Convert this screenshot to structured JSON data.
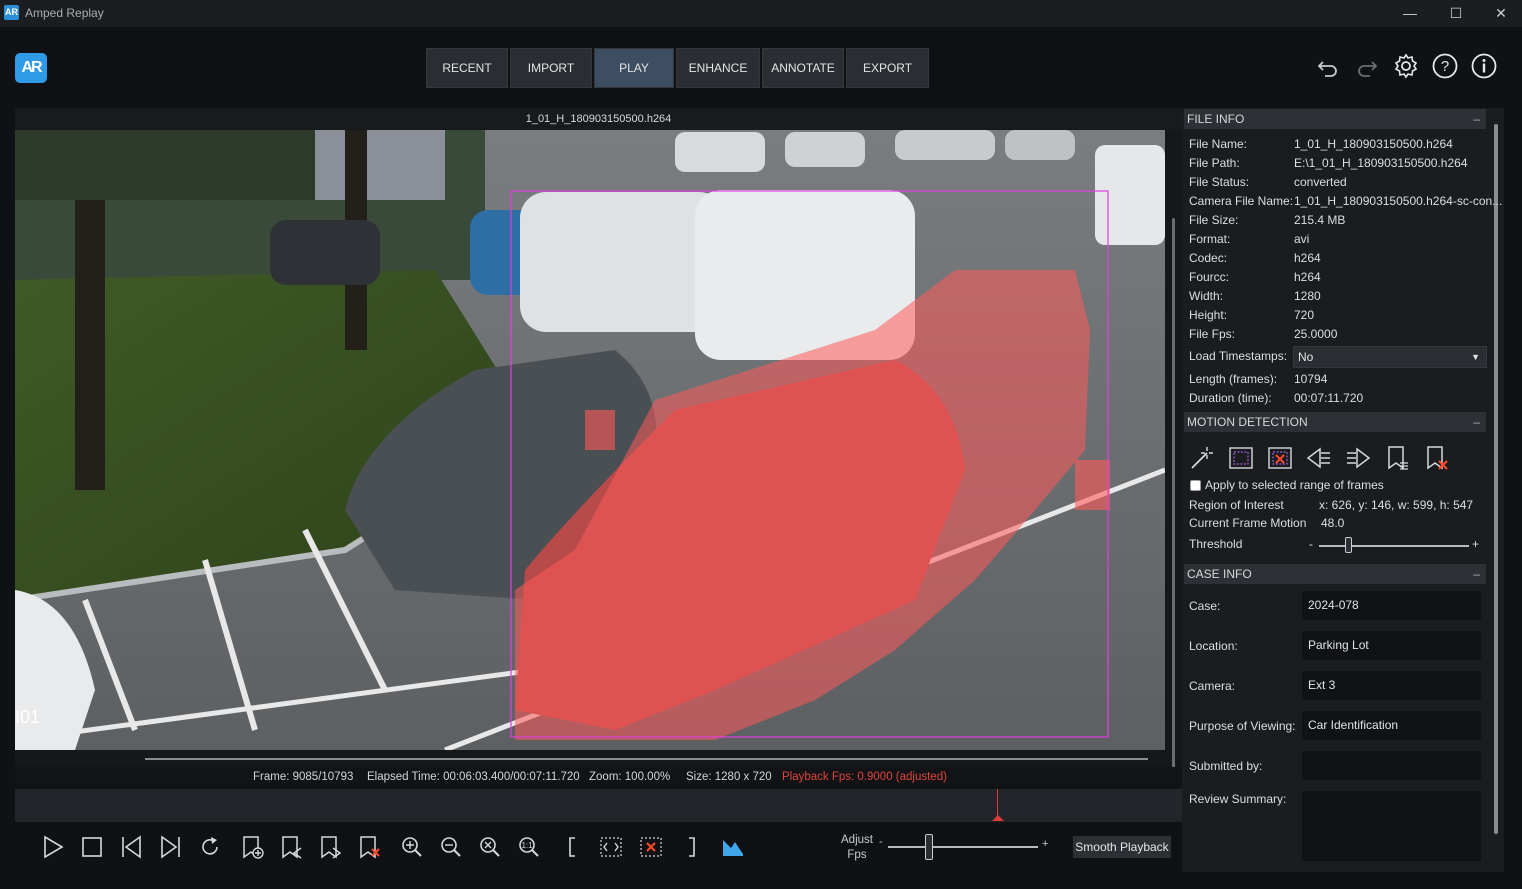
{
  "window": {
    "title": "Amped Replay",
    "icon_text": "AR",
    "minimize": "—",
    "maximize": "☐",
    "close": "✕"
  },
  "logo_text": "AR",
  "tabs": [
    {
      "label": "RECENT",
      "active": false
    },
    {
      "label": "IMPORT",
      "active": false
    },
    {
      "label": "PLAY",
      "active": true
    },
    {
      "label": "ENHANCE",
      "active": false
    },
    {
      "label": "ANNOTATE",
      "active": false
    },
    {
      "label": "EXPORT",
      "active": false
    }
  ],
  "top_icons": [
    "undo-icon",
    "redo-icon",
    "gear-icon",
    "help-icon",
    "info-icon"
  ],
  "video": {
    "filename": "1_01_H_180903150500.h264",
    "overlay_text": "I01",
    "motion_overlay_color": "#ff5a5a",
    "roi_color": "#e040e0"
  },
  "status": {
    "frame": "Frame: 9085/10793",
    "elapsed": "Elapsed Time: 00:06:03.400/00:07:11.720",
    "zoom": "Zoom: 100.00%",
    "size": "Size: 1280 x 720",
    "fps": "Playback Fps: 0.9000 (adjusted)"
  },
  "controls": {
    "buttons": [
      "play-icon",
      "stop-icon",
      "prev-frame-icon",
      "next-frame-icon",
      "loop-icon",
      "add-bookmark-icon",
      "prev-bookmark-icon",
      "next-bookmark-icon",
      "remove-bookmark-icon",
      "zoom-in-icon",
      "zoom-out-icon",
      "zoom-fit-icon",
      "zoom-100-icon",
      "range-start-icon",
      "range-select-icon",
      "range-clear-icon",
      "range-end-icon",
      "histogram-icon"
    ],
    "adjust_fps_label_1": "Adjust",
    "adjust_fps_label_2": "Fps",
    "adjust_minus": "-",
    "adjust_plus": "+",
    "smooth_playback": "Smooth Playback"
  },
  "file_info": {
    "header": "FILE INFO",
    "collapse": "–",
    "rows": [
      {
        "label": "File Name:",
        "value": "1_01_H_180903150500.h264"
      },
      {
        "label": "File Path:",
        "value": "E:\\1_01_H_180903150500.h264"
      },
      {
        "label": "File Status:",
        "value": "converted"
      },
      {
        "label": "Camera File Name:",
        "value": "1_01_H_180903150500.h264-sc-con..."
      },
      {
        "label": "File Size:",
        "value": "215.4 MB"
      },
      {
        "label": "Format:",
        "value": "avi"
      },
      {
        "label": "Codec:",
        "value": "h264"
      },
      {
        "label": "Fourcc:",
        "value": "h264"
      },
      {
        "label": "Width:",
        "value": "1280"
      },
      {
        "label": "Height:",
        "value": "720"
      },
      {
        "label": "File Fps:",
        "value": "25.0000"
      }
    ],
    "load_timestamps_label": "Load Timestamps:",
    "load_timestamps_value": "No",
    "length_label": "Length (frames):",
    "length_value": "10794",
    "duration_label": "Duration (time):",
    "duration_value": "00:07:11.720"
  },
  "motion_detection": {
    "header": "MOTION DETECTION",
    "collapse": "–",
    "tools": [
      "motion-wand-icon",
      "roi-select-icon",
      "roi-clear-icon",
      "prev-motion-icon",
      "next-motion-icon",
      "bookmark-motion-icon",
      "clear-bookmarks-icon"
    ],
    "apply_label": "Apply to selected range of frames",
    "roi_label": "Region of Interest",
    "roi_value": "x: 626,  y: 146,  w: 599,  h: 547",
    "motion_label": "Current Frame Motion",
    "motion_value": "48.0",
    "threshold_label": "Threshold",
    "threshold_minus": "-",
    "threshold_plus": "+",
    "threshold_level": 0.2
  },
  "case_info": {
    "header": "CASE INFO",
    "collapse": "–",
    "fields": [
      {
        "label": "Case:",
        "value": "2024-078"
      },
      {
        "label": "Location:",
        "value": "Parking Lot"
      },
      {
        "label": "Camera:",
        "value": "Ext 3"
      },
      {
        "label": "Purpose of Viewing:",
        "value": "Car Identification"
      },
      {
        "label": "Submitted by:",
        "value": ""
      },
      {
        "label": "Review Summary:",
        "value": ""
      }
    ]
  }
}
